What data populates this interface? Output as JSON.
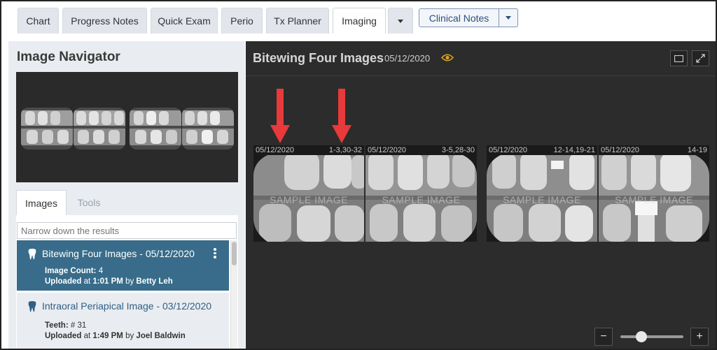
{
  "tabs": [
    {
      "label": "Chart"
    },
    {
      "label": "Progress Notes"
    },
    {
      "label": "Quick Exam"
    },
    {
      "label": "Perio"
    },
    {
      "label": "Tx Planner"
    },
    {
      "label": "Imaging",
      "active": true
    }
  ],
  "clinical_notes": {
    "label": "Clinical Notes"
  },
  "navigator": {
    "title": "Image Navigator",
    "tabs": {
      "images": "Images",
      "tools": "Tools"
    },
    "search_placeholder": "Narrow down the results",
    "items": [
      {
        "title": "Bitewing Four Images - 05/12/2020",
        "line1_label": "Image Count:",
        "line1_value": "4",
        "uploaded_label": "Uploaded",
        "at": "at",
        "time": "1:01 PM",
        "by": "by",
        "user": "Betty Leh"
      },
      {
        "title": "Intraoral Periapical Image - 03/12/2020",
        "line1_label": "Teeth:",
        "line1_value": "# 31",
        "uploaded_label": "Uploaded",
        "at": "at",
        "time": "1:49 PM",
        "by": "by",
        "user": "Joel Baldwin"
      }
    ]
  },
  "viewer": {
    "title": "Bitewing Four Images",
    "date": "05/12/2020",
    "images": [
      {
        "date": "05/12/2020",
        "teeth": "1-3,30-32",
        "watermark": "SAMPLE IMAGE"
      },
      {
        "date": "05/12/2020",
        "teeth": "3-5,28-30",
        "watermark": "SAMPLE IMAGE"
      },
      {
        "date": "05/12/2020",
        "teeth": "12-14,19-21",
        "watermark": "SAMPLE IMAGE"
      },
      {
        "date": "05/12/2020",
        "teeth": "14-19",
        "watermark": "SAMPLE IMAGE"
      }
    ],
    "zoom_out": "−",
    "zoom_in": "+",
    "zoom_level": 0.3
  },
  "colors": {
    "accent_selected": "#386c8a",
    "arrow": "#e8393b",
    "eye": "#d9a227"
  },
  "icons": [
    "tooth-icon",
    "kebab-menu-icon",
    "eye-icon",
    "single-view-icon",
    "expand-icon",
    "caret-down-icon"
  ]
}
